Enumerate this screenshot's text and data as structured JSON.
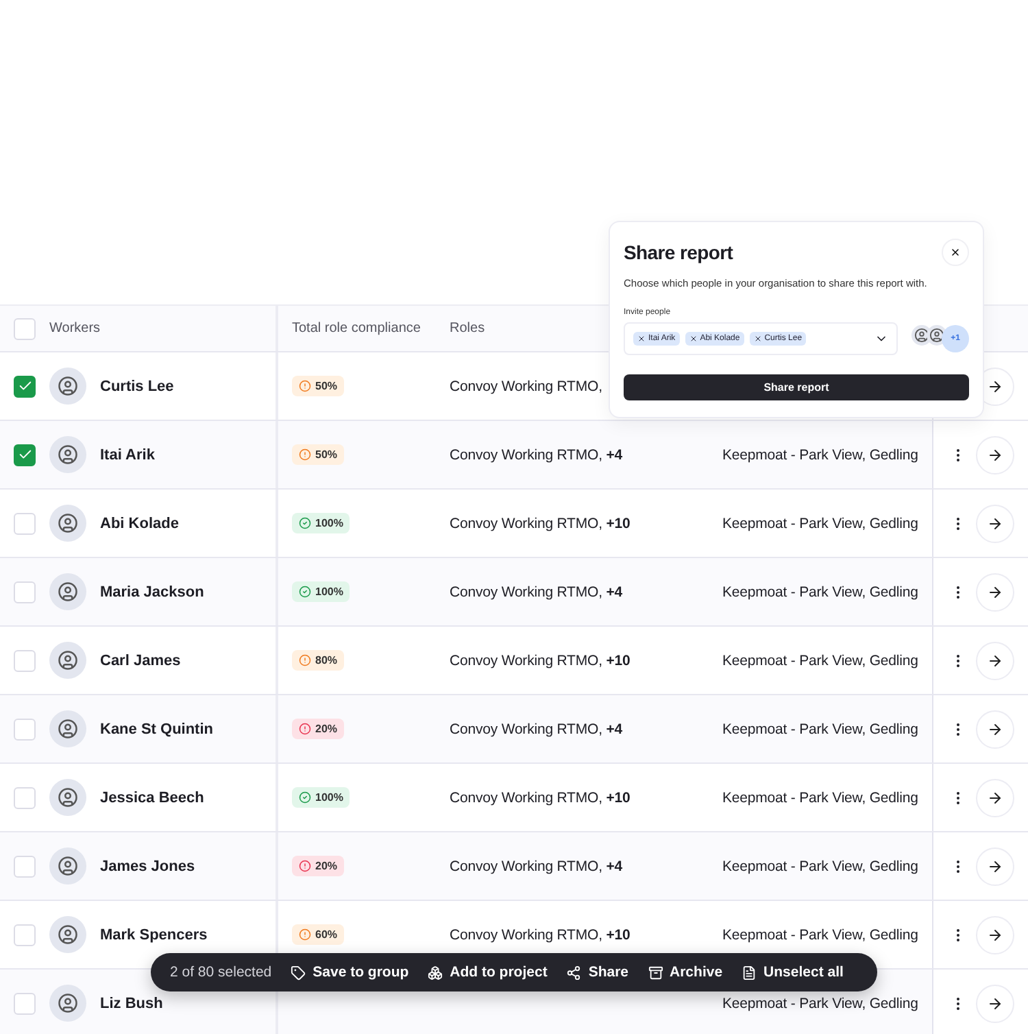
{
  "table": {
    "header_checkbox": {
      "checked": false
    },
    "columns": [
      "Workers",
      "Total role compliance",
      "Roles"
    ],
    "rows": [
      {
        "checked": true,
        "name": "Curtis Lee",
        "compliance": {
          "kind": "warn",
          "value": "50%"
        },
        "roles": "Convoy Working RTMO,"
      },
      {
        "checked": true,
        "name": "Itai Arik",
        "compliance": {
          "kind": "warn",
          "value": "50%"
        },
        "roles": "Convoy Working RTMO,",
        "roles_more": "+4",
        "location": "Keepmoat - Park View, Gedling"
      },
      {
        "checked": false,
        "name": "Abi Kolade",
        "compliance": {
          "kind": "ok",
          "value": "100%"
        },
        "roles": "Convoy Working RTMO,",
        "roles_more": "+10",
        "location": "Keepmoat - Park View, Gedling"
      },
      {
        "checked": false,
        "name": "Maria Jackson",
        "compliance": {
          "kind": "ok",
          "value": "100%"
        },
        "roles": "Convoy Working RTMO,",
        "roles_more": "+4",
        "location": "Keepmoat - Park View, Gedling"
      },
      {
        "checked": false,
        "name": "Carl James",
        "compliance": {
          "kind": "warn",
          "value": "80%"
        },
        "roles": "Convoy Working RTMO,",
        "roles_more": "+10",
        "location": "Keepmoat - Park View, Gedling"
      },
      {
        "checked": false,
        "name": "Kane St Quintin",
        "compliance": {
          "kind": "danger",
          "value": "20%"
        },
        "roles": "Convoy Working RTMO,",
        "roles_more": "+4",
        "location": "Keepmoat - Park View, Gedling"
      },
      {
        "checked": false,
        "name": "Jessica Beech",
        "compliance": {
          "kind": "ok",
          "value": "100%"
        },
        "roles": "Convoy Working RTMO,",
        "roles_more": "+10",
        "location": "Keepmoat - Park View, Gedling"
      },
      {
        "checked": false,
        "name": "James Jones",
        "compliance": {
          "kind": "danger",
          "value": "20%"
        },
        "roles": "Convoy Working RTMO,",
        "roles_more": "+4",
        "location": "Keepmoat - Park View, Gedling"
      },
      {
        "checked": false,
        "name": "Mark Spencers",
        "compliance": {
          "kind": "warn",
          "value": "60%"
        },
        "roles": "Convoy Working RTMO,",
        "roles_more": "+10",
        "location": "Keepmoat - Park View, Gedling"
      },
      {
        "checked": false,
        "name": "Liz Bush",
        "location": "Keepmoat - Park View, Gedling"
      }
    ]
  },
  "share_dialog": {
    "title": "Share report",
    "description": "Choose which people in your organisation to share this report with.",
    "invite_label": "Invite people",
    "chips": [
      "Itai Arik",
      "Abi Kolade",
      "Curtis Lee"
    ],
    "avatar_more": "+1",
    "button": "Share report"
  },
  "selection_bar": {
    "count": "2 of 80 selected",
    "actions": [
      {
        "kind": "tag",
        "label": "Save to group"
      },
      {
        "kind": "project",
        "label": "Add to project"
      },
      {
        "kind": "share",
        "label": "Share"
      },
      {
        "kind": "archive",
        "label": "Archive"
      },
      {
        "kind": "file",
        "label": "Unselect all"
      }
    ]
  }
}
